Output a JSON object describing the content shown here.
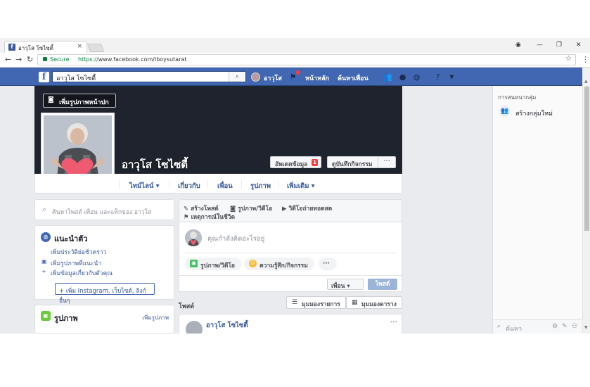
{
  "browser": {
    "tab_title": "อาวุโส โซไซตี้",
    "tab_close": "×",
    "secure_label": "Secure",
    "url_protocol": "https://",
    "url_rest": "www.facebook.com/iboysutarat",
    "back_icon": "arrow-left-icon",
    "forward_icon": "arrow-right-icon",
    "reload_icon": "reload-icon",
    "bookmark_icon": "star-icon",
    "menu_icon": "kebab-menu-icon"
  },
  "fbbar": {
    "logo": "f",
    "search_value": "อาวุโส โซไซตี้",
    "profile_name": "อาวุโส",
    "home": "หน้าหลัก",
    "find_friends": "ค้นหาเพื่อน"
  },
  "cover": {
    "add_cover": "เพิ่มรูปภาพหน้าปก",
    "name": "อาวุโส โซไซตี้",
    "update_info": "อัพเดตข้อมูล",
    "update_badge": "1",
    "activity_log": "ดูบันทึกกิจกรรม",
    "more": "···"
  },
  "profile_tabs": [
    "ไทม์ไลน์ ▾",
    "เกี่ยวกับ",
    "เพื่อน",
    "รูปภาพ",
    "เพิ่มเติม ▾"
  ],
  "left": {
    "search_placeholder": "ค้นหาโพสต์ เพื่อน และแท็กของ อาวุโส",
    "intro_title": "แนะนำตัว",
    "intro_links": [
      "เพิ่มประวัติย่อชั่วคราว",
      "เพิ่มรูปภาพที่แนะนำ",
      "เพิ่มข้อมูลเกี่ยวกับตัวคุณ"
    ],
    "add_links_button": "+ เพิ่ม Instagram, เว็บไซต์, ลิงก์อื่นๆ",
    "photos_title": "รูปภาพ",
    "photos_add": "เพิ่มรูปภาพ"
  },
  "composer": {
    "tabs": [
      "สร้างโพสต์",
      "รูปภาพ/วิดีโอ",
      "วิดีโอถ่ายทอดสด",
      "เหตุการณ์ในชีวิต"
    ],
    "placeholder": "คุณกำลังคิดอะไรอยู่",
    "pills": [
      "รูปภาพ/วิดีโอ",
      "ความรู้สึก/กิจกรรม",
      "···"
    ],
    "audience": "เพื่อน ▾",
    "post_button": "โพสต์"
  },
  "posts": {
    "header": "โพสต์",
    "list_view": "มุมมองรายการ",
    "grid_view": "มุมมองตาราง",
    "first_post_name": "อาวุโส โซไซตี้",
    "post_menu": "···"
  },
  "chat": {
    "header": "การสนทนากลุ่ม",
    "new_group": "สร้างกลุ่มใหม่",
    "search_placeholder": "ค้นหา"
  },
  "colors": {
    "fb_blue": "#4267b2",
    "link_blue": "#365899",
    "page_bg": "#e9ebee",
    "cover_dark": "#1e232d",
    "notification_red": "#fa3e3e"
  }
}
